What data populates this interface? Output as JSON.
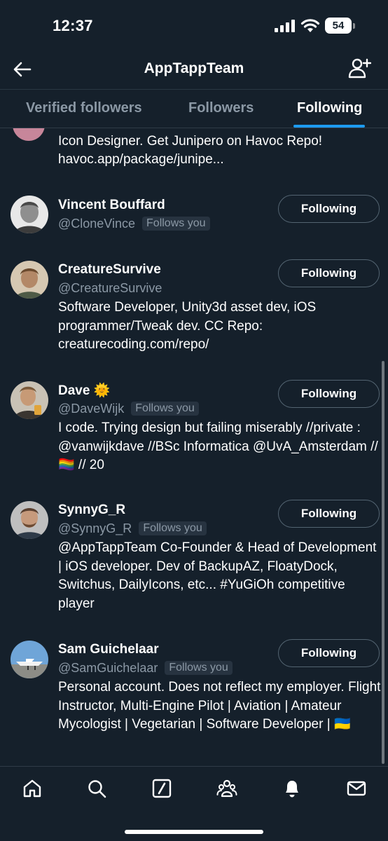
{
  "status_bar": {
    "time": "12:37",
    "battery": "54"
  },
  "header": {
    "title": "AppTappTeam"
  },
  "tabs": [
    {
      "label": "Verified followers",
      "active": false
    },
    {
      "label": "Followers",
      "active": false
    },
    {
      "label": "Following",
      "active": true
    }
  ],
  "partial_item": {
    "bio": "Icon Designer. Get Junipero on Havoc Repo! havoc.app/package/junipe..."
  },
  "users": [
    {
      "name": "Vincent Bouffard",
      "handle": "@CloneVince",
      "follows_you": "Follows you",
      "button": "Following",
      "bio": ""
    },
    {
      "name": "CreatureSurvive",
      "handle": "@CreatureSurvive",
      "follows_you": "",
      "button": "Following",
      "bio": "Software Developer, Unity3d asset dev, iOS programmer/Tweak dev. CC Repo: creaturecoding.com/repo/"
    },
    {
      "name": "Dave 🌞",
      "handle": "@DaveWijk",
      "follows_you": "Follows you",
      "button": "Following",
      "bio": "I code. Trying design but failing miserably //private : @vanwijkdave //BSc Informatica @UvA_Amsterdam // 🏳️‍🌈 // 20"
    },
    {
      "name": "SynnyG_R",
      "handle": "@SynnyG_R",
      "follows_you": "Follows you",
      "button": "Following",
      "bio": "@AppTappTeam Co-Founder & Head of Development | iOS developer. Dev of BackupAZ, FloatyDock, Switchus, DailyIcons, etc... #YuGiOh competitive player"
    },
    {
      "name": "Sam Guichelaar",
      "handle": "@SamGuichelaar",
      "follows_you": "Follows you",
      "button": "Following",
      "bio": "Personal account. Does not reflect my employer. Flight Instructor, Multi-Engine Pilot | Aviation | Amateur Mycologist | Vegetarian | Software Developer | 🇺🇦"
    }
  ],
  "bottom_nav": {
    "items": [
      "home-icon",
      "search-icon",
      "grok-icon",
      "communities-icon",
      "notifications-icon",
      "messages-icon"
    ]
  },
  "colors": {
    "background": "#15202b",
    "accent": "#1d9bf0",
    "secondary_text": "#8b98a5"
  }
}
